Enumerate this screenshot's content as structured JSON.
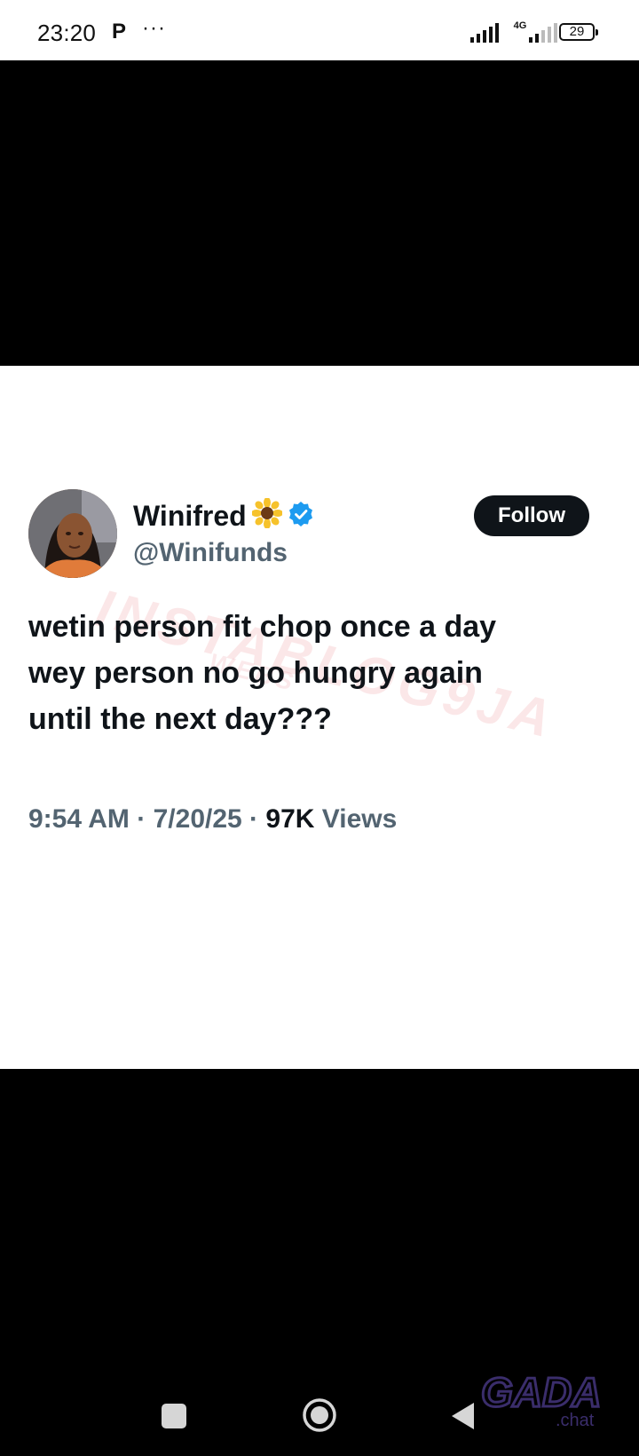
{
  "status_bar": {
    "time": "23:20",
    "app_indicator": "P",
    "more": "···",
    "network_label": "4G",
    "battery": "29"
  },
  "tweet": {
    "display_name": "Winifred",
    "name_emoji": "🌻",
    "verified_icon": "verified-badge-icon",
    "handle": "@Winifunds",
    "follow_label": "Follow",
    "text_lines": [
      "wetin person fit chop once a day",
      "wey person no go hungry again",
      "until the next day???"
    ],
    "time": "9:54 AM",
    "date": "7/20/25",
    "separator": "·",
    "views_count": "97K",
    "views_label": "Views",
    "watermark_main": "INSTABLOG9JA",
    "watermark_sub": "WEBS"
  },
  "nav_bar": {
    "recents_icon": "recents-square-icon",
    "home_icon": "home-circle-icon",
    "back_icon": "back-triangle-icon"
  },
  "overlay_logo": {
    "main": "GADA",
    "sub": ".chat"
  },
  "colors": {
    "text_primary": "#0f1419",
    "text_secondary": "#536471",
    "verified_blue": "#1d9bf0",
    "follow_bg": "#0f1419",
    "logo_purple": "#3a2d6b"
  }
}
